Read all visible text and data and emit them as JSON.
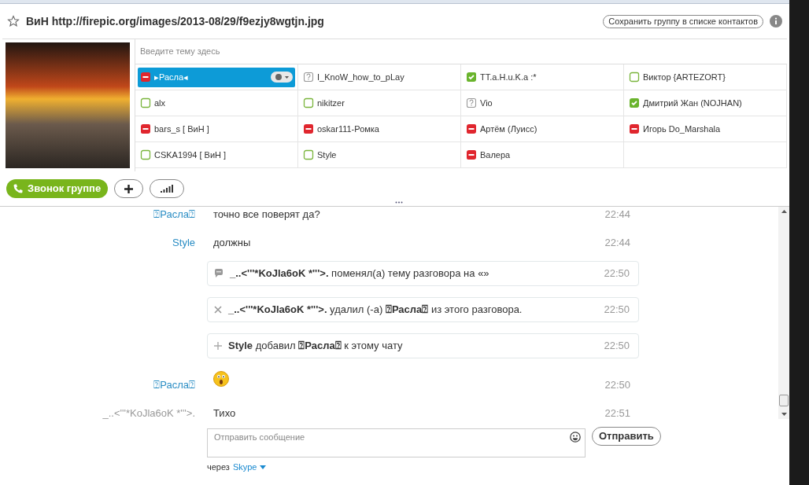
{
  "window": {
    "title": "ВиН http://firepic.org/images/2013-08/29/f9ezjy8wgtjn.jpg"
  },
  "save_group_button": "Сохранить группу в списке контактов",
  "topic": {
    "placeholder": "Введите тему здесь"
  },
  "participants": [
    {
      "name": "▸Расла◂",
      "kind": "busy",
      "selected": true
    },
    {
      "name": "I_KnoW_how_to_pLay",
      "kind": "unknown",
      "selected": false
    },
    {
      "name": "TT.a.H.u.K.a :*",
      "kind": "online",
      "selected": false
    },
    {
      "name": "Виктор {ARTEZORT}",
      "kind": "offline",
      "selected": false
    },
    {
      "name": "alx",
      "kind": "offline",
      "selected": false
    },
    {
      "name": "nikitzer",
      "kind": "offline",
      "selected": false
    },
    {
      "name": "Vio",
      "kind": "unknown",
      "selected": false
    },
    {
      "name": "Дмитрий Жан  (NOJHAN)",
      "kind": "online",
      "selected": false
    },
    {
      "name": "bars_s [ ВиН ]",
      "kind": "busy",
      "selected": false
    },
    {
      "name": "oskar111-Ромка",
      "kind": "busy",
      "selected": false
    },
    {
      "name": "Артём (Луисс)",
      "kind": "busy",
      "selected": false
    },
    {
      "name": "Игорь Do_Marshala",
      "kind": "busy",
      "selected": false
    },
    {
      "name": "CSKA1994 [ ВиН ]",
      "kind": "offline",
      "selected": false
    },
    {
      "name": "Style",
      "kind": "offline",
      "selected": false
    },
    {
      "name": "Валера",
      "kind": "busy",
      "selected": false
    }
  ],
  "call_button": "Звонок группе",
  "messages": [
    {
      "kind": "message",
      "sender": "⍰Расла⍰",
      "self": false,
      "text": "точно все поверят да?",
      "time": "22:44"
    },
    {
      "kind": "message",
      "sender": "Style",
      "self": false,
      "text": "должны",
      "time": "22:44"
    },
    {
      "kind": "topic-change",
      "text": "**_..<'''*KoJla6oK *'''>.** поменял(а) тему разговора на «»",
      "time": "22:50"
    },
    {
      "kind": "removal",
      "text": "**_..<'''*KoJla6oK *'''>.** удалил (-а) **⍰Расла⍰** из этого разговора.",
      "time": "22:50"
    },
    {
      "kind": "addition",
      "text": "**Style** добавил **⍰Расла⍰** к этому чату",
      "time": "22:50"
    },
    {
      "kind": "emoticon",
      "sender": "⍰Расла⍰",
      "self": false,
      "time": "22:50"
    },
    {
      "kind": "message",
      "sender": "_..<'''*KoJla6oK *'''>.",
      "self": true,
      "text": "Тихо",
      "time": "22:51"
    }
  ],
  "message_input": {
    "placeholder": "Отправить сообщение"
  },
  "send_button": "Отправить",
  "via": {
    "label": "через",
    "service": "Skype"
  }
}
